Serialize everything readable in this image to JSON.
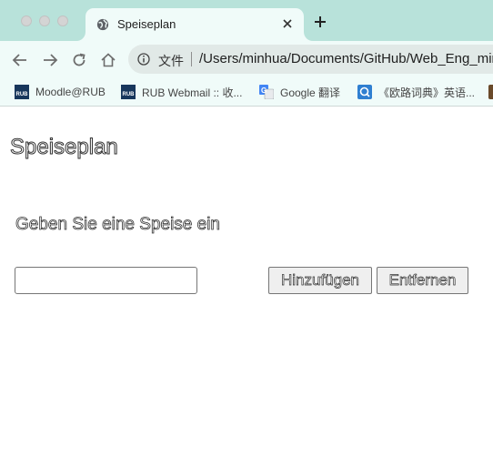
{
  "browser": {
    "tab": {
      "title": "Speiseplan",
      "favicon": "globe-icon"
    },
    "address_bar": {
      "scheme_label": "文件",
      "url": "/Users/minhua/Documents/GitHub/Web_Eng_min"
    },
    "bookmarks": [
      {
        "label": "Moodle@RUB",
        "icon": "rub-icon"
      },
      {
        "label": "RUB Webmail :: 收...",
        "icon": "rub-icon"
      },
      {
        "label": "Google 翻译",
        "icon": "translate-icon"
      },
      {
        "label": "《欧路词典》英语...",
        "icon": "dictionary-icon"
      }
    ]
  },
  "page": {
    "heading": "Speiseplan",
    "prompt": "Geben Sie eine Speise ein",
    "input": {
      "value": "",
      "placeholder": ""
    },
    "add_button": "Hinzufügen",
    "remove_button": "Entfernen"
  },
  "colors": {
    "tabstrip": "#b8e2da",
    "toolbar": "#f0fbf9",
    "omnibox": "#e1e9e7"
  }
}
